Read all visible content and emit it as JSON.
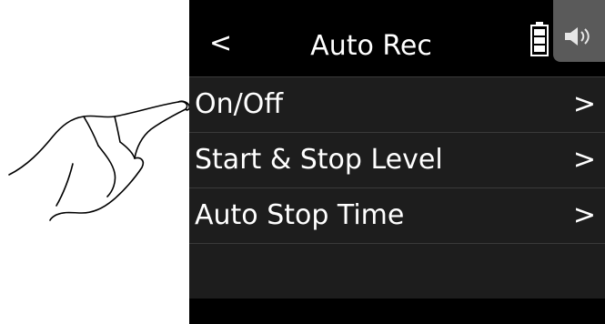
{
  "header": {
    "back_glyph": "<",
    "title": "Auto Rec",
    "battery_icon": "battery-icon",
    "speaker_icon": "speaker-icon"
  },
  "menu": {
    "items": [
      {
        "label": "On/Off",
        "chevron": ">"
      },
      {
        "label": "Start & Stop Level",
        "chevron": ">"
      },
      {
        "label": "Auto Stop Time",
        "chevron": ">"
      }
    ]
  },
  "colors": {
    "background": "#000000",
    "list_background": "#1d1d1d",
    "divider": "#3a3a3a",
    "speaker_tab": "#5a5a5a",
    "text": "#ffffff"
  }
}
